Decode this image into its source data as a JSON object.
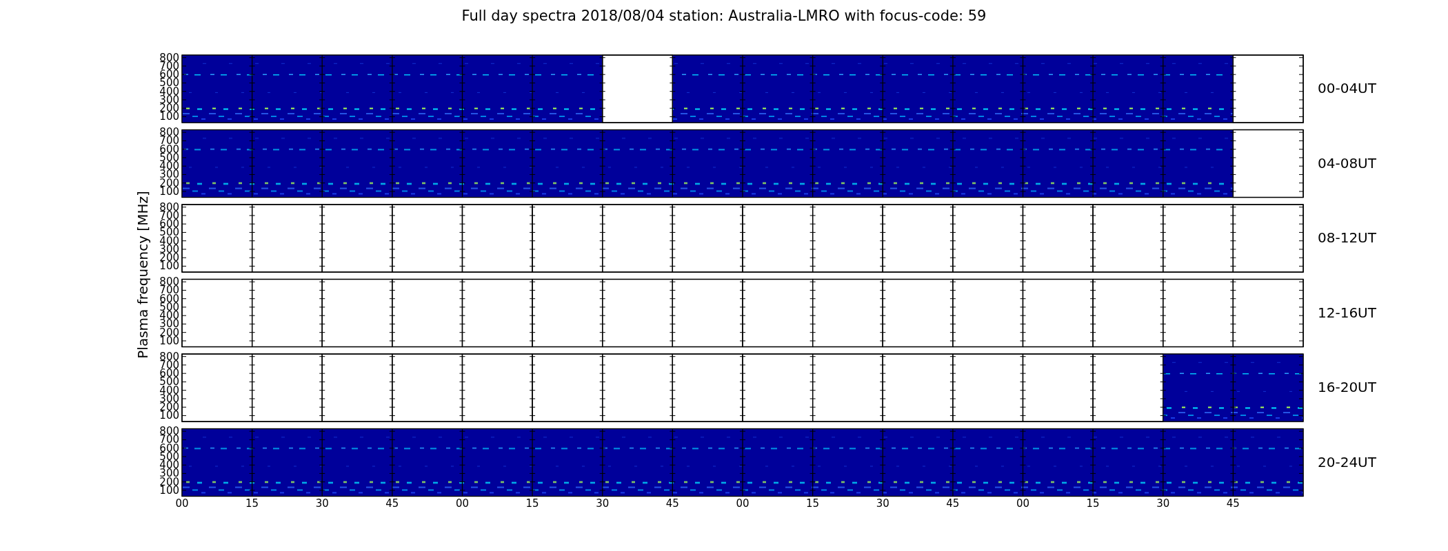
{
  "title": "Full day spectra 2018/08/04 station: Australia-LMRO with focus-code: 59",
  "ylabel": "Plasma frequency [MHz]",
  "panels": [
    {
      "label": "00-04UT",
      "yticks": [
        "800",
        "700",
        "600",
        "500",
        "400",
        "300",
        "200",
        "100"
      ],
      "segments": [
        {
          "has_data": true
        },
        {
          "has_data": true
        },
        {
          "has_data": true
        },
        {
          "has_data": true
        },
        {
          "has_data": true
        },
        {
          "has_data": true
        },
        {
          "has_data": false
        },
        {
          "has_data": true
        },
        {
          "has_data": true
        },
        {
          "has_data": true
        },
        {
          "has_data": true
        },
        {
          "has_data": true
        },
        {
          "has_data": true
        },
        {
          "has_data": true
        },
        {
          "has_data": true
        },
        {
          "has_data": false
        }
      ]
    },
    {
      "label": "04-08UT",
      "yticks": [
        "800",
        "700",
        "600",
        "500",
        "400",
        "300",
        "200",
        "100"
      ],
      "segments": [
        {
          "has_data": true
        },
        {
          "has_data": true
        },
        {
          "has_data": true
        },
        {
          "has_data": true
        },
        {
          "has_data": true
        },
        {
          "has_data": true
        },
        {
          "has_data": true
        },
        {
          "has_data": true
        },
        {
          "has_data": true
        },
        {
          "has_data": true
        },
        {
          "has_data": true
        },
        {
          "has_data": true
        },
        {
          "has_data": true
        },
        {
          "has_data": true
        },
        {
          "has_data": true
        },
        {
          "has_data": false
        }
      ]
    },
    {
      "label": "08-12UT",
      "yticks": [
        "800",
        "700",
        "600",
        "500",
        "400",
        "300",
        "200",
        "100"
      ],
      "segments": [
        {
          "has_data": false
        },
        {
          "has_data": false
        },
        {
          "has_data": false
        },
        {
          "has_data": false
        },
        {
          "has_data": false
        },
        {
          "has_data": false
        },
        {
          "has_data": false
        },
        {
          "has_data": false
        },
        {
          "has_data": false
        },
        {
          "has_data": false
        },
        {
          "has_data": false
        },
        {
          "has_data": false
        },
        {
          "has_data": false
        },
        {
          "has_data": false
        },
        {
          "has_data": false
        },
        {
          "has_data": false
        }
      ]
    },
    {
      "label": "12-16UT",
      "yticks": [
        "800",
        "700",
        "600",
        "500",
        "400",
        "300",
        "200",
        "100"
      ],
      "segments": [
        {
          "has_data": false
        },
        {
          "has_data": false
        },
        {
          "has_data": false
        },
        {
          "has_data": false
        },
        {
          "has_data": false
        },
        {
          "has_data": false
        },
        {
          "has_data": false
        },
        {
          "has_data": false
        },
        {
          "has_data": false
        },
        {
          "has_data": false
        },
        {
          "has_data": false
        },
        {
          "has_data": false
        },
        {
          "has_data": false
        },
        {
          "has_data": false
        },
        {
          "has_data": false
        },
        {
          "has_data": false
        }
      ]
    },
    {
      "label": "16-20UT",
      "yticks": [
        "800",
        "700",
        "600",
        "500",
        "400",
        "300",
        "200",
        "100"
      ],
      "segments": [
        {
          "has_data": false
        },
        {
          "has_data": false
        },
        {
          "has_data": false
        },
        {
          "has_data": false
        },
        {
          "has_data": false
        },
        {
          "has_data": false
        },
        {
          "has_data": false
        },
        {
          "has_data": false
        },
        {
          "has_data": false
        },
        {
          "has_data": false
        },
        {
          "has_data": false
        },
        {
          "has_data": false
        },
        {
          "has_data": false
        },
        {
          "has_data": false
        },
        {
          "has_data": true
        },
        {
          "has_data": true
        }
      ]
    },
    {
      "label": "20-24UT",
      "yticks": [
        "800",
        "700",
        "600",
        "500",
        "400",
        "300",
        "200",
        "100"
      ],
      "segments": [
        {
          "has_data": true
        },
        {
          "has_data": true
        },
        {
          "has_data": true
        },
        {
          "has_data": true
        },
        {
          "has_data": true
        },
        {
          "has_data": true
        },
        {
          "has_data": true
        },
        {
          "has_data": true
        },
        {
          "has_data": true
        },
        {
          "has_data": true
        },
        {
          "has_data": true
        },
        {
          "has_data": true
        },
        {
          "has_data": true
        },
        {
          "has_data": true
        },
        {
          "has_data": true
        },
        {
          "has_data": true
        }
      ]
    }
  ],
  "xticks": [
    "00",
    "15",
    "30",
    "45",
    "00",
    "15",
    "30",
    "45",
    "00",
    "15",
    "30",
    "45",
    "00",
    "15",
    "30",
    "45"
  ]
}
